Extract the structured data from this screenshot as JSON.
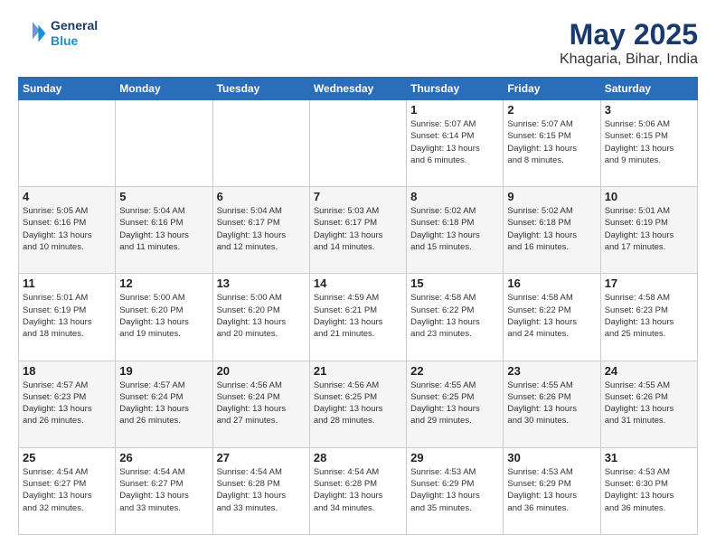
{
  "logo": {
    "line1": "General",
    "line2": "Blue"
  },
  "title": {
    "month": "May 2025",
    "location": "Khagaria, Bihar, India"
  },
  "weekdays": [
    "Sunday",
    "Monday",
    "Tuesday",
    "Wednesday",
    "Thursday",
    "Friday",
    "Saturday"
  ],
  "weeks": [
    [
      {
        "day": null,
        "text": null
      },
      {
        "day": null,
        "text": null
      },
      {
        "day": null,
        "text": null
      },
      {
        "day": null,
        "text": null
      },
      {
        "day": "1",
        "text": "Sunrise: 5:07 AM\nSunset: 6:14 PM\nDaylight: 13 hours\nand 6 minutes."
      },
      {
        "day": "2",
        "text": "Sunrise: 5:07 AM\nSunset: 6:15 PM\nDaylight: 13 hours\nand 8 minutes."
      },
      {
        "day": "3",
        "text": "Sunrise: 5:06 AM\nSunset: 6:15 PM\nDaylight: 13 hours\nand 9 minutes."
      }
    ],
    [
      {
        "day": "4",
        "text": "Sunrise: 5:05 AM\nSunset: 6:16 PM\nDaylight: 13 hours\nand 10 minutes."
      },
      {
        "day": "5",
        "text": "Sunrise: 5:04 AM\nSunset: 6:16 PM\nDaylight: 13 hours\nand 11 minutes."
      },
      {
        "day": "6",
        "text": "Sunrise: 5:04 AM\nSunset: 6:17 PM\nDaylight: 13 hours\nand 12 minutes."
      },
      {
        "day": "7",
        "text": "Sunrise: 5:03 AM\nSunset: 6:17 PM\nDaylight: 13 hours\nand 14 minutes."
      },
      {
        "day": "8",
        "text": "Sunrise: 5:02 AM\nSunset: 6:18 PM\nDaylight: 13 hours\nand 15 minutes."
      },
      {
        "day": "9",
        "text": "Sunrise: 5:02 AM\nSunset: 6:18 PM\nDaylight: 13 hours\nand 16 minutes."
      },
      {
        "day": "10",
        "text": "Sunrise: 5:01 AM\nSunset: 6:19 PM\nDaylight: 13 hours\nand 17 minutes."
      }
    ],
    [
      {
        "day": "11",
        "text": "Sunrise: 5:01 AM\nSunset: 6:19 PM\nDaylight: 13 hours\nand 18 minutes."
      },
      {
        "day": "12",
        "text": "Sunrise: 5:00 AM\nSunset: 6:20 PM\nDaylight: 13 hours\nand 19 minutes."
      },
      {
        "day": "13",
        "text": "Sunrise: 5:00 AM\nSunset: 6:20 PM\nDaylight: 13 hours\nand 20 minutes."
      },
      {
        "day": "14",
        "text": "Sunrise: 4:59 AM\nSunset: 6:21 PM\nDaylight: 13 hours\nand 21 minutes."
      },
      {
        "day": "15",
        "text": "Sunrise: 4:58 AM\nSunset: 6:22 PM\nDaylight: 13 hours\nand 23 minutes."
      },
      {
        "day": "16",
        "text": "Sunrise: 4:58 AM\nSunset: 6:22 PM\nDaylight: 13 hours\nand 24 minutes."
      },
      {
        "day": "17",
        "text": "Sunrise: 4:58 AM\nSunset: 6:23 PM\nDaylight: 13 hours\nand 25 minutes."
      }
    ],
    [
      {
        "day": "18",
        "text": "Sunrise: 4:57 AM\nSunset: 6:23 PM\nDaylight: 13 hours\nand 26 minutes."
      },
      {
        "day": "19",
        "text": "Sunrise: 4:57 AM\nSunset: 6:24 PM\nDaylight: 13 hours\nand 26 minutes."
      },
      {
        "day": "20",
        "text": "Sunrise: 4:56 AM\nSunset: 6:24 PM\nDaylight: 13 hours\nand 27 minutes."
      },
      {
        "day": "21",
        "text": "Sunrise: 4:56 AM\nSunset: 6:25 PM\nDaylight: 13 hours\nand 28 minutes."
      },
      {
        "day": "22",
        "text": "Sunrise: 4:55 AM\nSunset: 6:25 PM\nDaylight: 13 hours\nand 29 minutes."
      },
      {
        "day": "23",
        "text": "Sunrise: 4:55 AM\nSunset: 6:26 PM\nDaylight: 13 hours\nand 30 minutes."
      },
      {
        "day": "24",
        "text": "Sunrise: 4:55 AM\nSunset: 6:26 PM\nDaylight: 13 hours\nand 31 minutes."
      }
    ],
    [
      {
        "day": "25",
        "text": "Sunrise: 4:54 AM\nSunset: 6:27 PM\nDaylight: 13 hours\nand 32 minutes."
      },
      {
        "day": "26",
        "text": "Sunrise: 4:54 AM\nSunset: 6:27 PM\nDaylight: 13 hours\nand 33 minutes."
      },
      {
        "day": "27",
        "text": "Sunrise: 4:54 AM\nSunset: 6:28 PM\nDaylight: 13 hours\nand 33 minutes."
      },
      {
        "day": "28",
        "text": "Sunrise: 4:54 AM\nSunset: 6:28 PM\nDaylight: 13 hours\nand 34 minutes."
      },
      {
        "day": "29",
        "text": "Sunrise: 4:53 AM\nSunset: 6:29 PM\nDaylight: 13 hours\nand 35 minutes."
      },
      {
        "day": "30",
        "text": "Sunrise: 4:53 AM\nSunset: 6:29 PM\nDaylight: 13 hours\nand 36 minutes."
      },
      {
        "day": "31",
        "text": "Sunrise: 4:53 AM\nSunset: 6:30 PM\nDaylight: 13 hours\nand 36 minutes."
      }
    ]
  ]
}
